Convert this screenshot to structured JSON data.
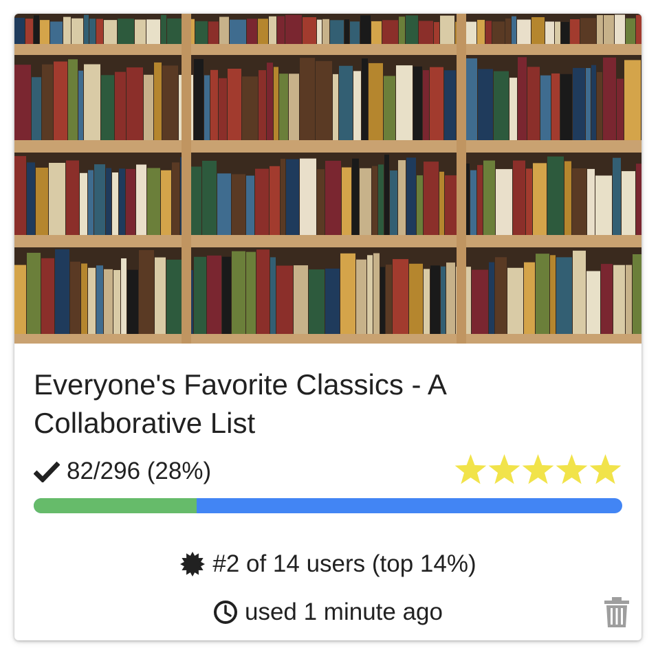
{
  "card": {
    "image_alt": "bookshelf",
    "title": "Everyone's Favorite Classics - A Collaborative List",
    "progress_text": "82/296 (28%)",
    "progress_fraction": 0.277,
    "rating_stars": 5,
    "rank_text": "#2 of 14 users (top 14%)",
    "used_text": "used 1 minute ago"
  },
  "icons": {
    "check": "check-icon",
    "star": "star-icon",
    "badge": "badge-icon",
    "clock": "clock-icon",
    "trash": "trash-icon"
  },
  "colors": {
    "star": "#f1e34a",
    "progress_done": "#66bb6a",
    "progress_remaining": "#4285f4",
    "text": "#212121",
    "trash": "#9e9e9e"
  }
}
